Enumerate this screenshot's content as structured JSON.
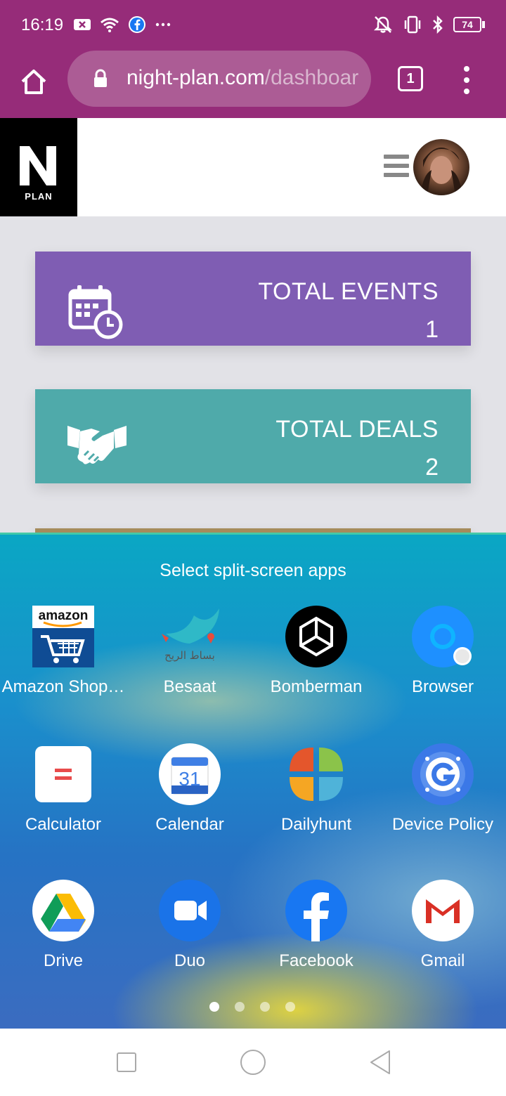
{
  "status_bar": {
    "time": "16:19",
    "battery": "74"
  },
  "browser": {
    "url_domain": "night-plan.com",
    "url_path": "/dashboard",
    "tab_count": "1"
  },
  "site": {
    "logo_text": "PLAN"
  },
  "cards": [
    {
      "title": "TOTAL EVENTS",
      "value": "1",
      "color": "#7f5db3"
    },
    {
      "title": "TOTAL DEALS",
      "value": "2",
      "color": "#4faaaa"
    }
  ],
  "split_screen": {
    "title": "Select split-screen apps",
    "apps": [
      {
        "label": "Amazon Shop…",
        "icon": "amazon-icon"
      },
      {
        "label": "Besaat",
        "icon": "besaat-icon"
      },
      {
        "label": "Bomberman",
        "icon": "unity-icon"
      },
      {
        "label": "Browser",
        "icon": "browser-icon"
      },
      {
        "label": "Calculator",
        "icon": "calculator-icon"
      },
      {
        "label": "Calendar",
        "icon": "calendar-icon",
        "day": "31"
      },
      {
        "label": "Dailyhunt",
        "icon": "dailyhunt-icon"
      },
      {
        "label": "Device Policy",
        "icon": "device-policy-icon"
      },
      {
        "label": "Drive",
        "icon": "drive-icon"
      },
      {
        "label": "Duo",
        "icon": "duo-icon"
      },
      {
        "label": "Facebook",
        "icon": "facebook-icon"
      },
      {
        "label": "Gmail",
        "icon": "gmail-icon"
      }
    ],
    "amazon_text": "amazon",
    "besaat_text": "بساط الريح",
    "page_count": 4,
    "active_page": 1
  }
}
